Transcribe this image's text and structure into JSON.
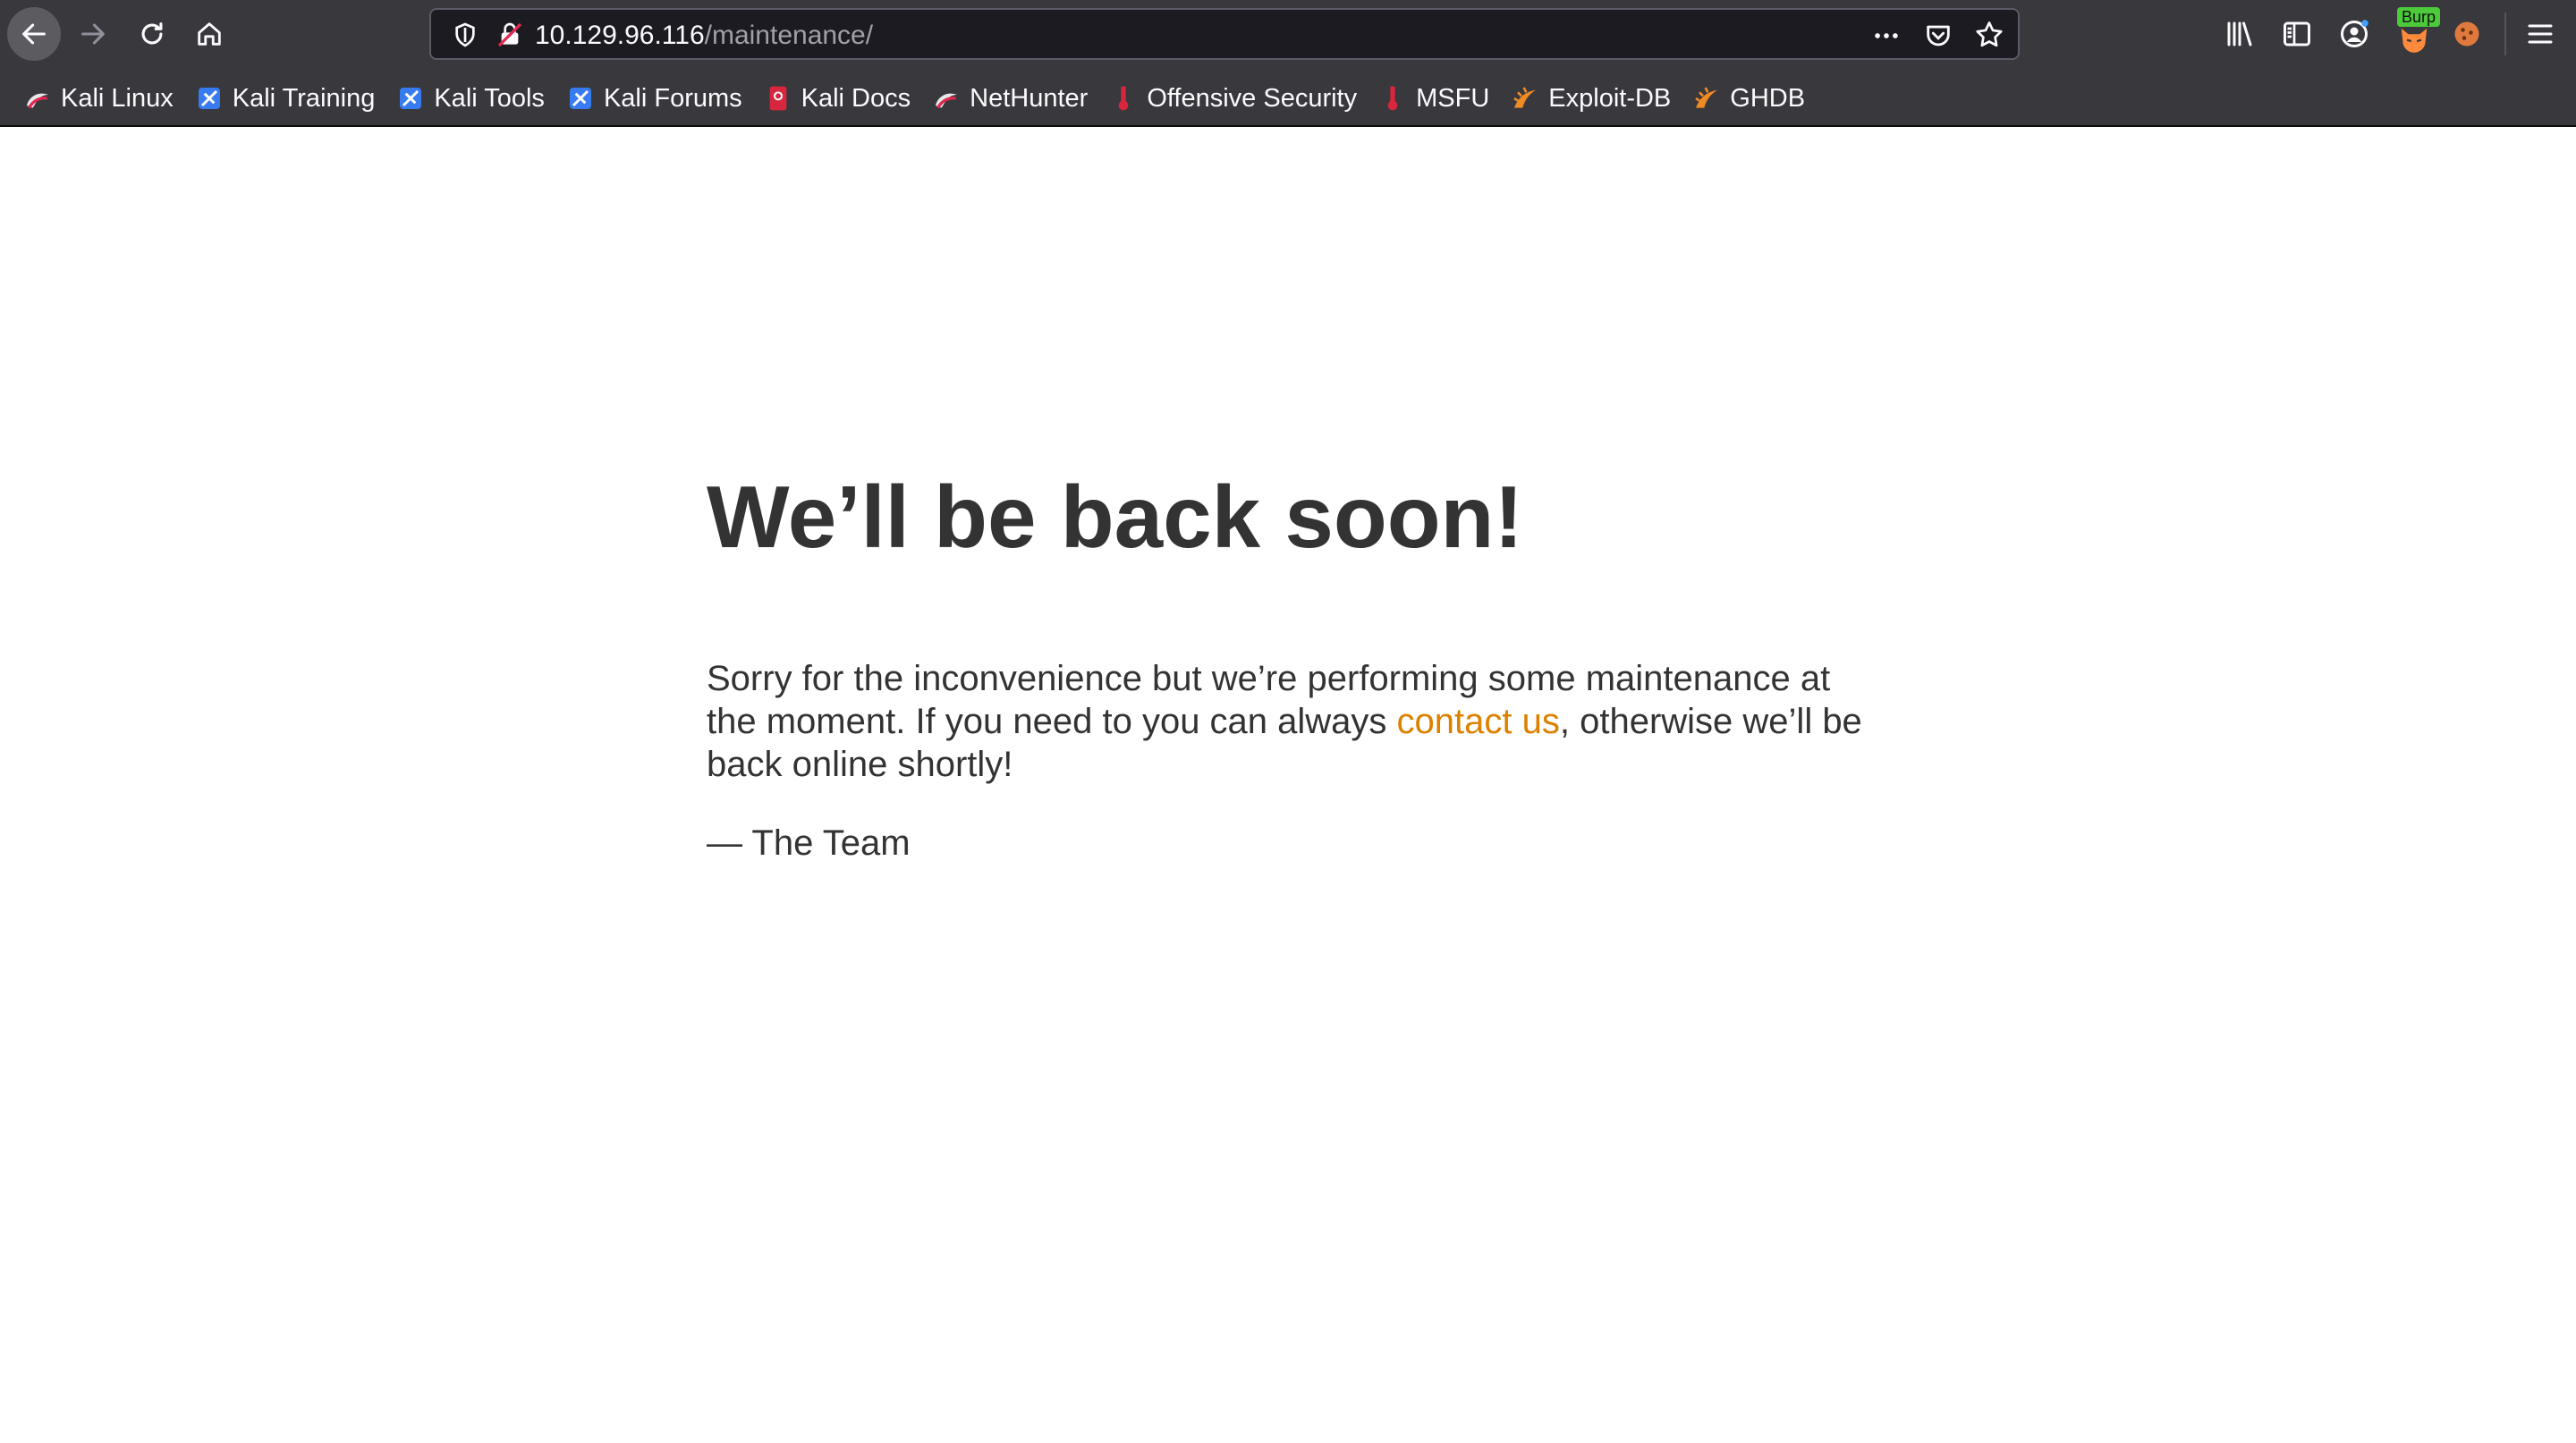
{
  "browser": {
    "url": {
      "host": "10.129.96.116",
      "path": "/maintenance/"
    },
    "extensions": {
      "burp_badge": "Burp"
    },
    "bookmarks": [
      {
        "label": "Kali Linux",
        "icon": "kali-dragon-icon"
      },
      {
        "label": "Kali Training",
        "icon": "kali-training-icon"
      },
      {
        "label": "Kali Tools",
        "icon": "kali-tools-icon"
      },
      {
        "label": "Kali Forums",
        "icon": "kali-forums-icon"
      },
      {
        "label": "Kali Docs",
        "icon": "kali-docs-icon"
      },
      {
        "label": "NetHunter",
        "icon": "nethunter-icon"
      },
      {
        "label": "Offensive Security",
        "icon": "offsec-icon"
      },
      {
        "label": "MSFU",
        "icon": "msfu-icon"
      },
      {
        "label": "Exploit-DB",
        "icon": "exploit-db-icon"
      },
      {
        "label": "GHDB",
        "icon": "ghdb-icon"
      }
    ]
  },
  "page": {
    "title": "We’ll be back soon!",
    "message_before": "Sorry for the inconvenience but we’re performing some maintenance at the moment. If you need to you can always ",
    "contact_link": "contact us",
    "message_after": ", otherwise we’ll be back online shortly!",
    "signature": "— The Team",
    "link_color": "#dc8100",
    "text_color": "#333333"
  }
}
